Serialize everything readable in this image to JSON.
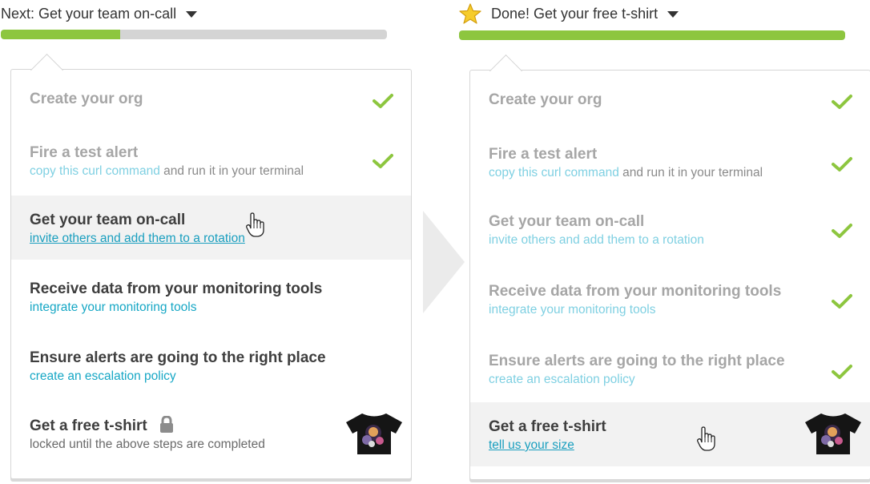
{
  "left_panel": {
    "header_prefix": "Next: Get your team on-call",
    "progress_fraction": 0.31,
    "progress_color": "#8dc63f",
    "steps": [
      {
        "title": "Create your org",
        "status": "done"
      },
      {
        "title": "Fire a test alert",
        "link": "copy this curl command",
        "rest": " and run it in your terminal",
        "status": "done"
      },
      {
        "title": "Get your team on-call",
        "link": "invite others and add them to a rotation",
        "status": "active"
      },
      {
        "title": "Receive data from your monitoring tools",
        "link": "integrate your monitoring tools",
        "status": "todo"
      },
      {
        "title": "Ensure alerts are going to the right place",
        "link": "create an escalation policy",
        "status": "todo"
      },
      {
        "title": "Get a free t-shirt",
        "note": "locked until the above steps are completed",
        "status": "locked"
      }
    ]
  },
  "right_panel": {
    "header": "Done! Get your free t-shirt",
    "progress_fraction": 1.0,
    "progress_color": "#8dc63f",
    "steps": [
      {
        "title": "Create your org",
        "status": "done"
      },
      {
        "title": "Fire a test alert",
        "link": "copy this curl command",
        "rest": " and run it in your terminal",
        "status": "done"
      },
      {
        "title": "Get your team on-call",
        "link": "invite others and add them to a rotation",
        "status": "done"
      },
      {
        "title": "Receive data from your monitoring tools",
        "link": "integrate your monitoring tools",
        "status": "done"
      },
      {
        "title": "Ensure alerts are going to the right place",
        "link": "create an escalation policy",
        "status": "done"
      },
      {
        "title": "Get a free t-shirt",
        "link": "tell us your size",
        "status": "active"
      }
    ]
  },
  "icons": {
    "check": "check-icon",
    "lock": "lock-icon",
    "star": "star-icon",
    "caret": "caret-down-icon",
    "cursor": "hand-pointer-icon",
    "tshirt": "tshirt-image",
    "arrow": "arrow-right-icon"
  },
  "colors": {
    "check": "#8dc63f",
    "link": "#16a7c5",
    "progress_track": "#d4d4d4"
  }
}
